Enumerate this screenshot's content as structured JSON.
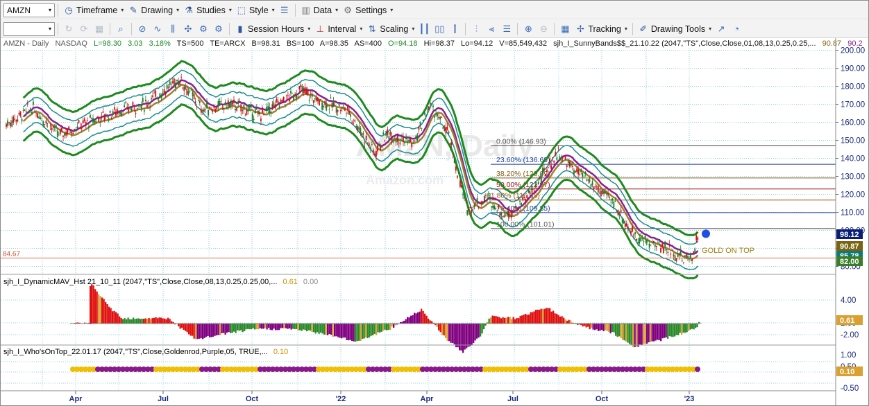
{
  "toolbar1": {
    "symbol": "AMZN",
    "timeframe": "Timeframe",
    "drawing": "Drawing",
    "studies": "Studies",
    "style": "Style",
    "data": "Data",
    "settings": "Settings"
  },
  "toolbar2": {
    "session": "Session Hours",
    "interval": "Interval",
    "scaling": "Scaling",
    "tracking": "Tracking",
    "drawing_tools": "Drawing Tools"
  },
  "header": {
    "symbol": "AMZN - Daily",
    "exchange": "NASDAQ",
    "L": "L=98.30",
    "chg": "3.03",
    "pct": "3.18%",
    "ts": "TS=500",
    "te": "TE=ARCX",
    "b": "B=98.31",
    "bs": "BS=100",
    "a": "A=98.35",
    "as": "AS=400",
    "o": "O=94.18",
    "hi": "Hi=98.37",
    "lo": "Lo=94.12",
    "v": "V=85,549,432",
    "study": "sjh_I_SunnyBands$$_21.10.22 (2047,\"TS\",Close,Close,01,08,13,0.25,0.25,...",
    "v1": "90.87",
    "v2": "90.2"
  },
  "watermark": {
    "title": "AMZN, Daily",
    "sub": "Amazon.com"
  },
  "fib": [
    {
      "label": "0.00% (146.93)",
      "price": 146.93
    },
    {
      "label": "23.60% (136.69)",
      "price": 136.69
    },
    {
      "label": "38.20% (129.09)",
      "price": 129.09
    },
    {
      "label": "50.00% (122.97)",
      "price": 122.97
    },
    {
      "label": "61.80% (116.85)",
      "price": 116.85
    },
    {
      "label": "76.40% (109.85)",
      "price": 109.85
    },
    {
      "label": "100.00% (101.01)",
      "price": 101.01
    }
  ],
  "hline": {
    "label": "84.67",
    "price": 84.67
  },
  "annotation": "GOLD ON TOP",
  "price_axis": {
    "ticks": [
      "200.00",
      "190.00",
      "180.00",
      "170.00",
      "160.00",
      "150.00",
      "140.00",
      "130.00",
      "120.00",
      "110.00",
      "100.00",
      "90.00",
      "80.00"
    ],
    "markers": [
      {
        "label": "98.12",
        "color": "#0a1e78"
      },
      {
        "label": "90.87",
        "color": "#7a6410"
      },
      {
        "label": "85.78",
        "color": "#0e7a78"
      },
      {
        "label": "82.00",
        "color": "#3a7d2a"
      }
    ]
  },
  "panel2": {
    "title": "sjh_I_DynamicMAV_Hst 21_10_11 (2047,\"TS\",Close,Close,08,13,0.25,0.25,00,...",
    "v1": "0.61",
    "v2": "0.00",
    "ticks": [
      "4.00",
      "2.00",
      "-2.00"
    ],
    "marker": "0.61"
  },
  "panel3": {
    "title": "sjh_I_Who'sOnTop_22.01.17 (2047,\"TS\",Close,Goldenrod,Purple,05, TRUE,...",
    "v1": "0.10",
    "ticks": [
      "1.00",
      "0.50",
      "-0.50"
    ],
    "marker": "0.10"
  },
  "x_axis": [
    "Apr",
    "Jul",
    "Oct",
    "'22",
    "Apr",
    "Jul",
    "Oct",
    "'23"
  ],
  "chart_data": {
    "type": "candlestick",
    "symbol": "AMZN",
    "interval": "Daily",
    "ylim": [
      78,
      205
    ],
    "trend": [
      [
        "2021-01-04",
        159
      ],
      [
        "2021-02-01",
        168
      ],
      [
        "2021-03-01",
        153
      ],
      [
        "2021-04-01",
        160
      ],
      [
        "2021-05-01",
        166
      ],
      [
        "2021-06-01",
        170
      ],
      [
        "2021-07-08",
        184
      ],
      [
        "2021-08-01",
        167
      ],
      [
        "2021-09-01",
        170
      ],
      [
        "2021-10-01",
        164
      ],
      [
        "2021-11-15",
        178
      ],
      [
        "2021-12-01",
        172
      ],
      [
        "2022-01-03",
        167
      ],
      [
        "2022-01-15",
        157
      ],
      [
        "2022-02-01",
        143
      ],
      [
        "2022-02-15",
        154
      ],
      [
        "2022-03-15",
        148
      ],
      [
        "2022-04-01",
        170
      ],
      [
        "2022-04-20",
        154
      ],
      [
        "2022-05-10",
        112
      ],
      [
        "2022-06-01",
        118
      ],
      [
        "2022-06-20",
        108
      ],
      [
        "2022-07-20",
        122
      ],
      [
        "2022-08-15",
        143
      ],
      [
        "2022-09-01",
        134
      ],
      [
        "2022-10-15",
        115
      ],
      [
        "2022-10-31",
        100
      ],
      [
        "2022-11-15",
        94
      ],
      [
        "2022-12-10",
        90
      ],
      [
        "2022-12-28",
        84
      ],
      [
        "2023-01-06",
        86
      ],
      [
        "2023-01-11",
        95
      ],
      [
        "2023-01-13",
        98
      ]
    ]
  },
  "colors": {
    "up": "#1a7a2a",
    "down": "#c41515",
    "band_outer": "#1f8a1f",
    "band_inner": "#1a8c8c",
    "mid_gold": "#a08030",
    "mid_purple": "#8a2090",
    "hist_red": "#e01010",
    "hist_gold": "#daa032",
    "hist_purple": "#800080",
    "hist_green": "#2a8a2a",
    "dot_gold": "#f0c000",
    "dot_purple": "#8a1a8a"
  }
}
